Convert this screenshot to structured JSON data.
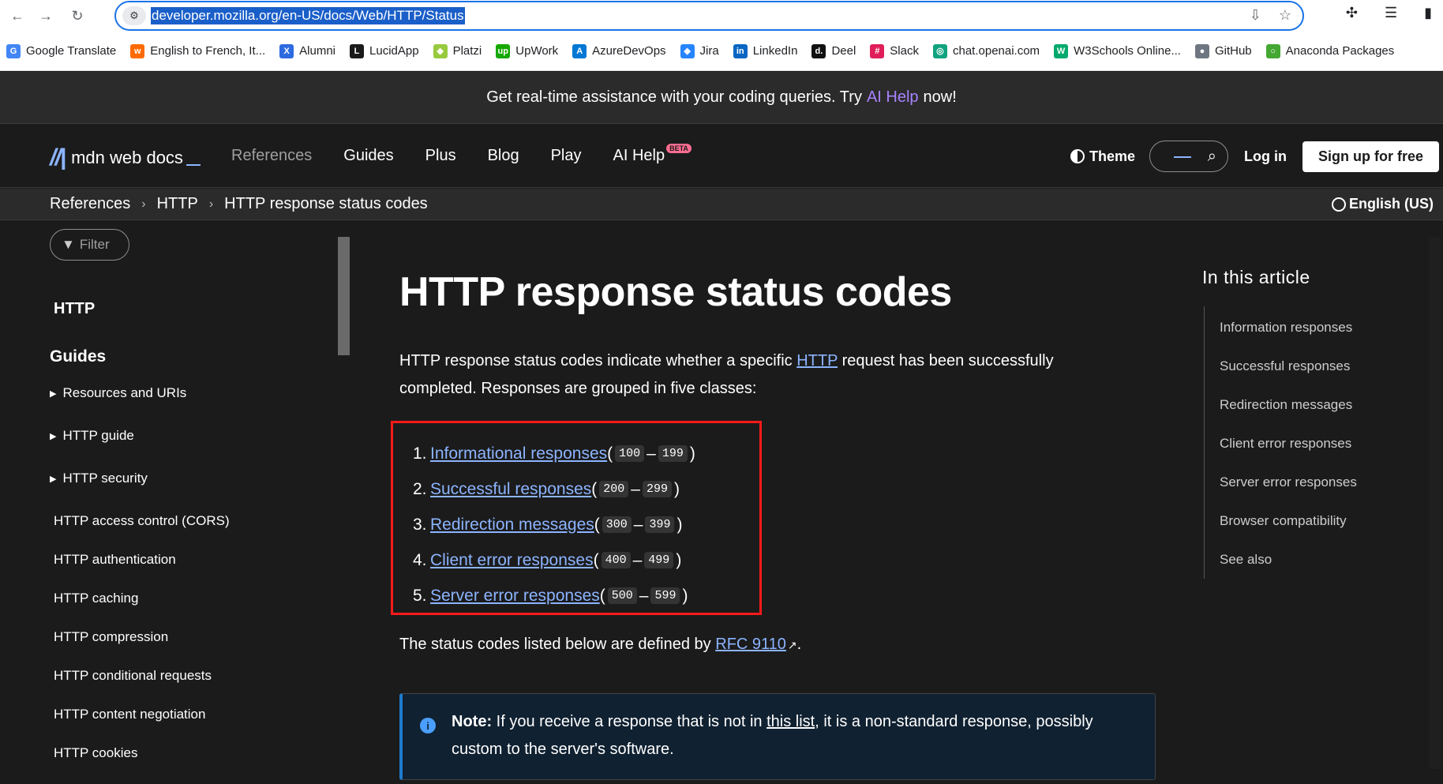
{
  "browser": {
    "url": "developer.mozilla.org/en-US/docs/Web/HTTP/Status",
    "bookmarks": [
      {
        "label": "Google Translate",
        "color": "#4285f4",
        "glyph": "G"
      },
      {
        "label": "English to French, It...",
        "color": "#ff6b00",
        "glyph": "w"
      },
      {
        "label": "Alumni",
        "color": "#2d6ae0",
        "glyph": "X"
      },
      {
        "label": "LucidApp",
        "color": "#1b1b1b",
        "glyph": "L"
      },
      {
        "label": "Platzi",
        "color": "#98ca3f",
        "glyph": "◆"
      },
      {
        "label": "UpWork",
        "color": "#14a800",
        "glyph": "up"
      },
      {
        "label": "AzureDevOps",
        "color": "#0078d4",
        "glyph": "A"
      },
      {
        "label": "Jira",
        "color": "#2684ff",
        "glyph": "◆"
      },
      {
        "label": "LinkedIn",
        "color": "#0a66c2",
        "glyph": "in"
      },
      {
        "label": "Deel",
        "color": "#111111",
        "glyph": "d."
      },
      {
        "label": "Slack",
        "color": "#e01e5a",
        "glyph": "#"
      },
      {
        "label": "chat.openai.com",
        "color": "#10a37f",
        "glyph": "◎"
      },
      {
        "label": "W3Schools Online...",
        "color": "#04aa6d",
        "glyph": "W"
      },
      {
        "label": "GitHub",
        "color": "#6e7681",
        "glyph": "●"
      },
      {
        "label": "Anaconda Packages",
        "color": "#44a833",
        "glyph": "○"
      }
    ]
  },
  "banner": {
    "text_before": "Get real-time assistance with your coding queries. Try",
    "link": "AI Help",
    "text_after": "now!"
  },
  "header": {
    "logo": "mdn web docs",
    "nav": [
      "References",
      "Guides",
      "Plus",
      "Blog",
      "Play",
      "AI Help"
    ],
    "beta": "BETA",
    "theme": "Theme",
    "login": "Log in",
    "signup": "Sign up for free"
  },
  "breadcrumbs": [
    "References",
    "HTTP",
    "HTTP response status codes"
  ],
  "language": "English (US)",
  "sidebar": {
    "filter_placeholder": "Filter",
    "heading": "HTTP",
    "guides": "Guides",
    "collapsible": [
      "Resources and URIs",
      "HTTP guide",
      "HTTP security"
    ],
    "items": [
      "HTTP access control (CORS)",
      "HTTP authentication",
      "HTTP caching",
      "HTTP compression",
      "HTTP conditional requests",
      "HTTP content negotiation",
      "HTTP cookies"
    ]
  },
  "article": {
    "title": "HTTP response status codes",
    "intro_1": "HTTP response status codes indicate whether a specific",
    "intro_link": "HTTP",
    "intro_2": "request has been successfully completed. Responses are grouped in five classes:",
    "classes": [
      {
        "num": "1.",
        "label": "Informational responses",
        "from": "100",
        "to": "199"
      },
      {
        "num": "2.",
        "label": "Successful responses",
        "from": "200",
        "to": "299"
      },
      {
        "num": "3.",
        "label": "Redirection messages",
        "from": "300",
        "to": "399"
      },
      {
        "num": "4.",
        "label": "Client error responses",
        "from": "400",
        "to": "499"
      },
      {
        "num": "5.",
        "label": "Server error responses",
        "from": "500",
        "to": "599"
      }
    ],
    "status_text": "The status codes listed below are defined by",
    "status_link": "RFC 9110",
    "note_label": "Note:",
    "note_text_1": "If you receive a response that is not in",
    "note_link": "this list",
    "note_text_2": ", it is a non-standard response, possibly custom to the server's software."
  },
  "toc": {
    "heading": "In this article",
    "items": [
      "Information responses",
      "Successful responses",
      "Redirection messages",
      "Client error responses",
      "Server error responses",
      "Browser compatibility",
      "See also"
    ]
  }
}
